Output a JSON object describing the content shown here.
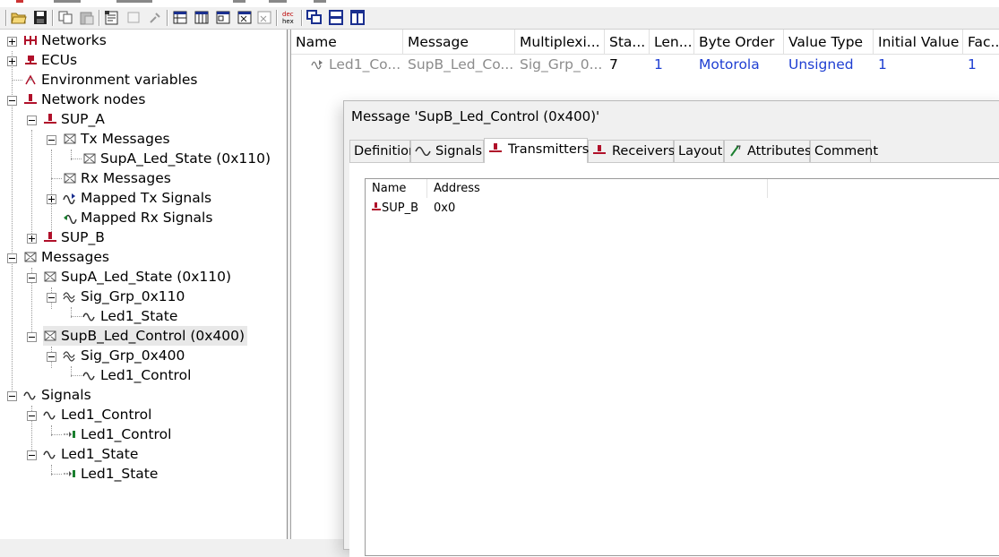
{
  "toolbar": {
    "icons": [
      "open-folder-icon",
      "save-icon",
      "copy-icon",
      "paste-icon",
      "properties-icon",
      "blank-doc-icon",
      "find-icon",
      "table-view-icon",
      "columns-view-icon",
      "details-view-icon",
      "list-view-icon",
      "filter-view-icon",
      "dec-hex-icon",
      "cascade-icon",
      "tile-horizontal-icon",
      "tile-vertical-icon"
    ],
    "dec_hex_label": "dec hex"
  },
  "tree": {
    "networks": "Networks",
    "ecus": "ECUs",
    "env_vars": "Environment variables",
    "network_nodes": "Network nodes",
    "sup_a": "SUP_A",
    "tx_messages": "Tx Messages",
    "supa_led_state_tx": "SupA_Led_State (0x110)",
    "rx_messages": "Rx Messages",
    "mapped_tx": "Mapped Tx Signals",
    "mapped_rx": "Mapped Rx Signals",
    "sup_b": "SUP_B",
    "messages": "Messages",
    "supa_led_state": "SupA_Led_State (0x110)",
    "sig_grp_110": "Sig_Grp_0x110",
    "led1_state_a": "Led1_State",
    "supb_led_control": "SupB_Led_Control (0x400)",
    "sig_grp_400": "Sig_Grp_0x400",
    "led1_control_a": "Led1_Control",
    "signals": "Signals",
    "led1_control_sig": "Led1_Control",
    "led1_control_sub": "Led1_Control",
    "led1_state_sig": "Led1_State",
    "led1_state_sub": "Led1_State"
  },
  "list": {
    "columns": [
      "Name",
      "Message",
      "Multiplexi...",
      "Sta...",
      "Len...",
      "Byte Order",
      "Value Type",
      "Initial Value",
      "Fac..."
    ],
    "row": {
      "name": "Led1_Co...",
      "message": "SupB_Led_Co...",
      "multiplexing": "Sig_Grp_0...",
      "start": "7",
      "length": "1",
      "byte_order": "Motorola",
      "value_type": "Unsigned",
      "initial_value": "1",
      "factor": "1"
    }
  },
  "dialog": {
    "title": "Message 'SupB_Led_Control (0x400)'",
    "tabs": {
      "definition": "Definition",
      "signals": "Signals",
      "transmitters": "Transmitters",
      "receivers": "Receivers",
      "layout": "Layout",
      "attributes": "Attributes",
      "comment": "Comment"
    },
    "active_tab": "Transmitters",
    "table": {
      "col_name": "Name",
      "col_address": "Address",
      "row_name": "SUP_B",
      "row_address": "0x0"
    }
  },
  "colors": {
    "value_blue": "#1f3fd2",
    "disabled_gray": "#8c8c8c",
    "node_red": "#c8102e"
  }
}
